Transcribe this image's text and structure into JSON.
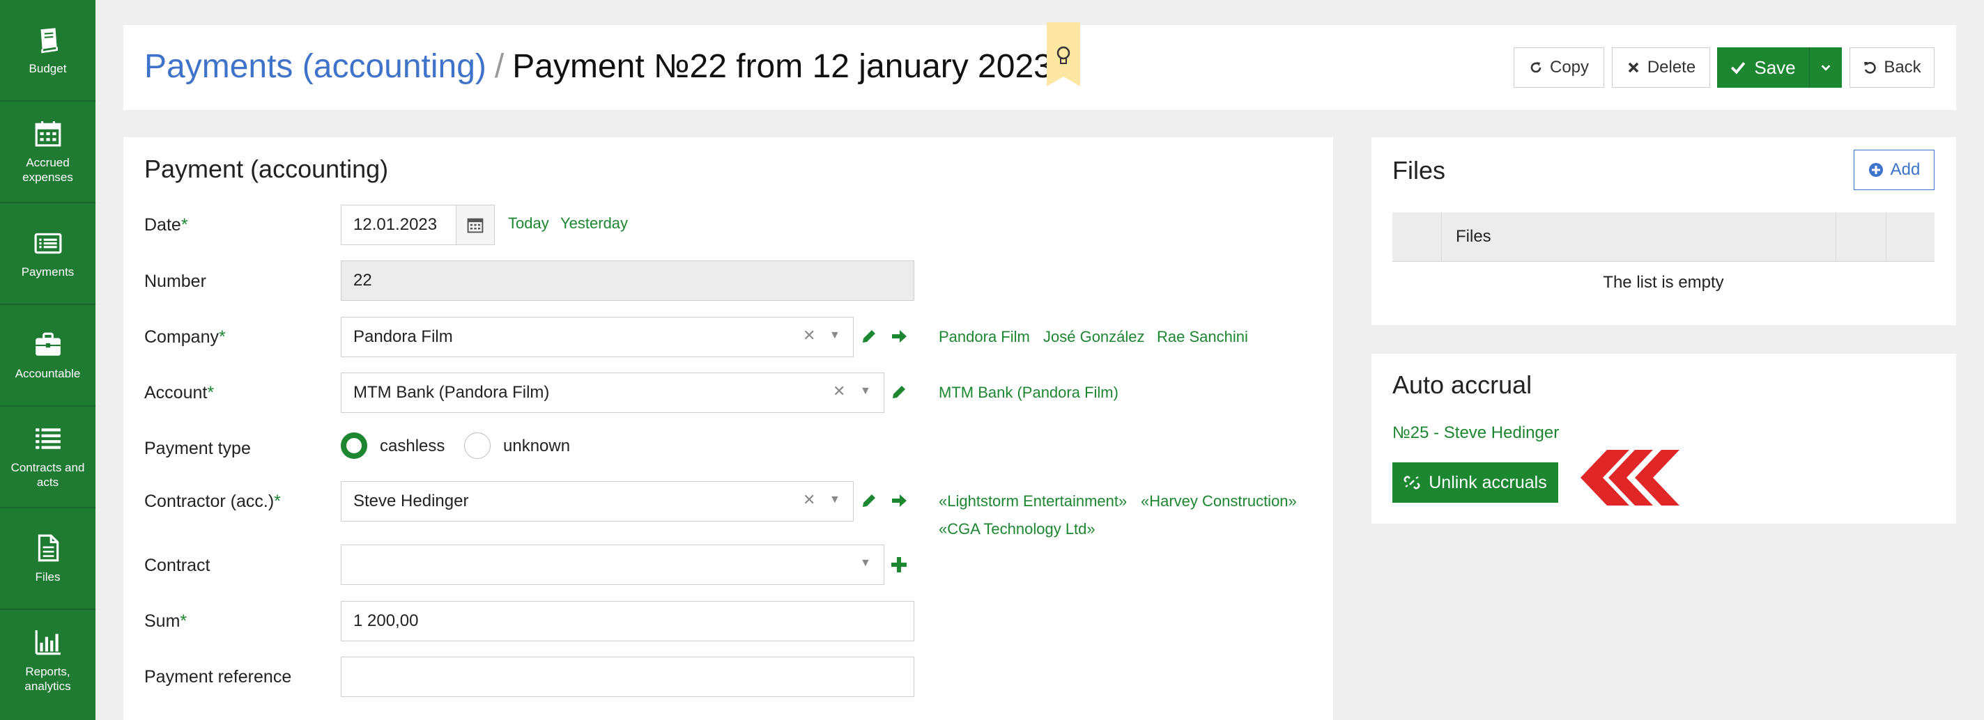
{
  "sidebar": {
    "items": [
      {
        "label": "Budget",
        "icon": "book-icon"
      },
      {
        "label": "Accrued expenses",
        "icon": "calendar-icon"
      },
      {
        "label": "Payments",
        "icon": "payments-list-icon"
      },
      {
        "label": "Accountable",
        "icon": "briefcase-icon"
      },
      {
        "label": "Contracts and acts",
        "icon": "list-icon"
      },
      {
        "label": "Files",
        "icon": "file-icon"
      },
      {
        "label": "Reports, analytics",
        "icon": "bar-chart-icon"
      }
    ]
  },
  "header": {
    "breadcrumb": "Payments (accounting)",
    "separator": "/",
    "title": "Payment №22 from 12 january 2023",
    "buttons": {
      "copy": "Copy",
      "delete": "Delete",
      "save": "Save",
      "back": "Back"
    }
  },
  "form": {
    "title": "Payment (accounting)",
    "date": {
      "label": "Date",
      "value": "12.01.2023",
      "today": "Today",
      "yesterday": "Yesterday"
    },
    "number": {
      "label": "Number",
      "value": "22"
    },
    "company": {
      "label": "Company",
      "value": "Pandora Film",
      "links": [
        "Pandora Film",
        "José González",
        "Rae Sanchini"
      ]
    },
    "account": {
      "label": "Account",
      "value": "MTM Bank (Pandora Film)",
      "links": [
        "MTM Bank (Pandora Film)"
      ]
    },
    "payment_type": {
      "label": "Payment type",
      "options": [
        "cashless",
        "unknown"
      ],
      "selected": "cashless"
    },
    "contractor": {
      "label": "Contractor (acc.)",
      "value": "Steve Hedinger",
      "links": [
        "«Lightstorm Entertainment»",
        "«Harvey Construction»",
        "«CGA Technology Ltd»"
      ]
    },
    "contract": {
      "label": "Contract",
      "value": ""
    },
    "sum": {
      "label": "Sum",
      "value": "1 200,00"
    },
    "payment_reference": {
      "label": "Payment reference",
      "value": ""
    },
    "required_mark": "*"
  },
  "files": {
    "title": "Files",
    "add_label": "Add",
    "column_header": "Files",
    "empty_text": "The list is empty"
  },
  "auto_accrual": {
    "title": "Auto accrual",
    "link": "№25 - Steve Hedinger",
    "unlink_label": "Unlink accruals"
  },
  "colors": {
    "sidebar": "#1f7a32",
    "accent_green": "#1d8630",
    "link_blue": "#3f73c9",
    "annotation_red": "#e02626"
  }
}
